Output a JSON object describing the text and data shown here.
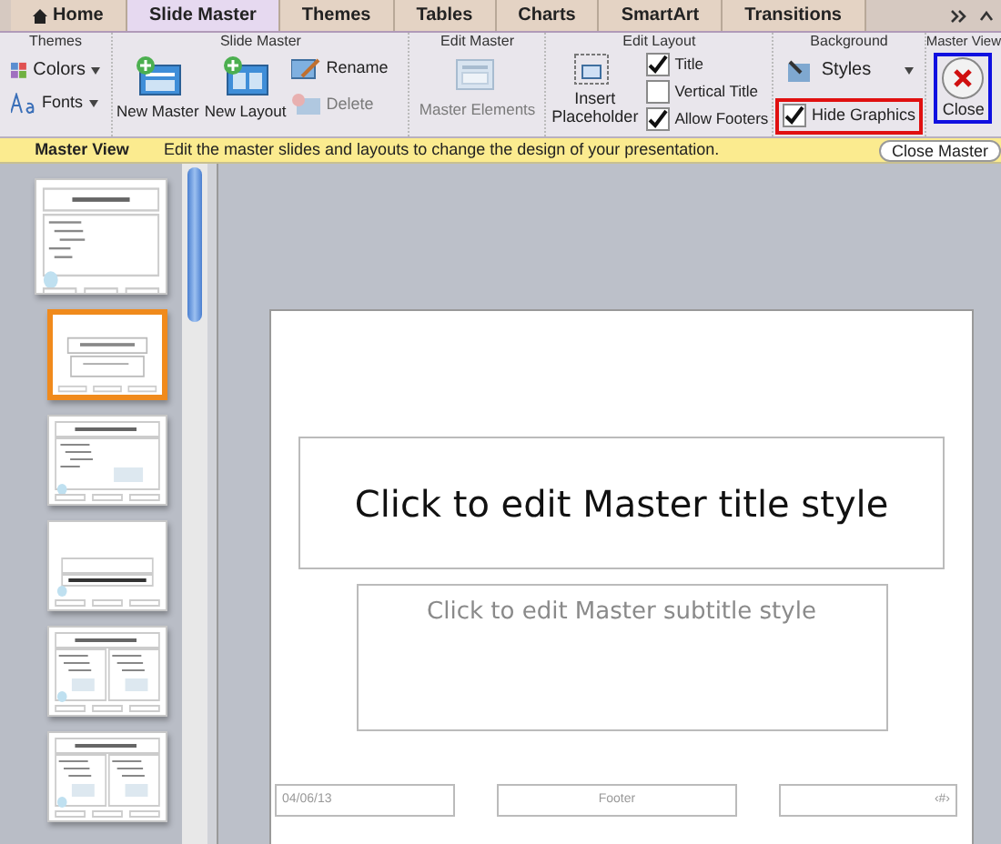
{
  "tabs": [
    {
      "label": "Home",
      "selected": false
    },
    {
      "label": "Slide Master",
      "selected": true
    },
    {
      "label": "Themes",
      "selected": false
    },
    {
      "label": "Tables",
      "selected": false
    },
    {
      "label": "Charts",
      "selected": false
    },
    {
      "label": "SmartArt",
      "selected": false
    },
    {
      "label": "Transitions",
      "selected": false
    }
  ],
  "ribbon": {
    "themes": {
      "title": "Themes",
      "colors": "Colors",
      "fonts": "Fonts"
    },
    "slide_master": {
      "title": "Slide Master",
      "new_master": "New Master",
      "new_layout": "New Layout",
      "rename": "Rename",
      "delete": {
        "label": "Delete",
        "disabled": true
      }
    },
    "edit_master": {
      "title": "Edit Master",
      "master_elements": {
        "label": "Master Elements",
        "disabled": true
      }
    },
    "edit_layout": {
      "title": "Edit Layout",
      "insert_placeholder": "Insert Placeholder",
      "options": [
        {
          "label": "Title",
          "checked": true
        },
        {
          "label": "Vertical Title",
          "checked": false
        },
        {
          "label": "Allow Footers",
          "checked": true
        }
      ]
    },
    "background": {
      "title": "Background",
      "styles": "Styles",
      "hide_graphics": {
        "label": "Hide Graphics",
        "checked": true
      }
    },
    "master_view": {
      "title": "Master View",
      "close": "Close"
    }
  },
  "message_bar": {
    "title": "Master View",
    "text": "Edit the master slides and layouts to change the design of your presentation.",
    "button": "Close Master"
  },
  "thumbnails": [
    {
      "kind": "master",
      "selected": false
    },
    {
      "kind": "title",
      "selected": true
    },
    {
      "kind": "content",
      "selected": false
    },
    {
      "kind": "section",
      "selected": false
    },
    {
      "kind": "two",
      "selected": false
    },
    {
      "kind": "two",
      "selected": false
    }
  ],
  "slide": {
    "title": "Click to edit Master title style",
    "subtitle": "Click to edit Master subtitle style",
    "date": "04/06/13",
    "footer": "Footer",
    "number": "‹#›"
  }
}
